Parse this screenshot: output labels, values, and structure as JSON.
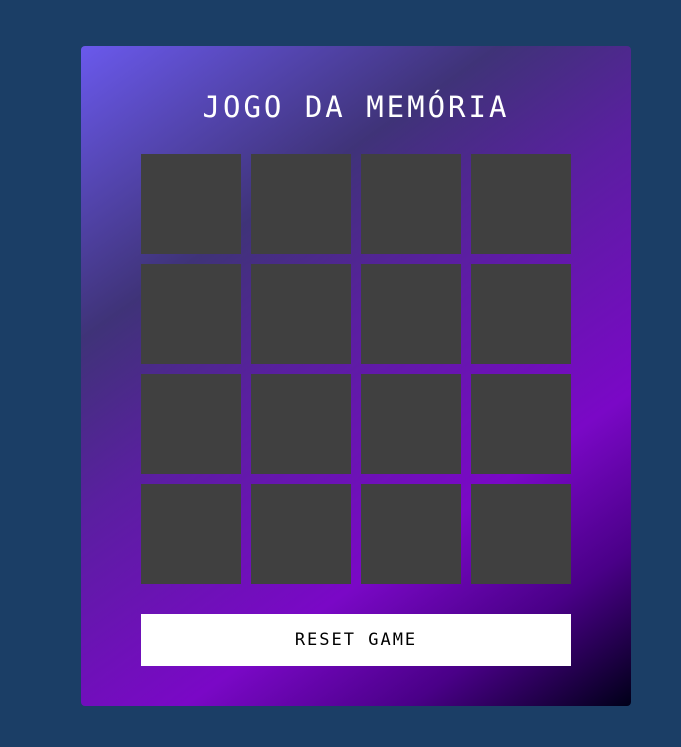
{
  "game": {
    "title": "JOGO DA MEMÓRIA",
    "reset_label": "RESET GAME",
    "card_count": 16,
    "card_color": "#404040",
    "background_color": "#1b3e66"
  }
}
